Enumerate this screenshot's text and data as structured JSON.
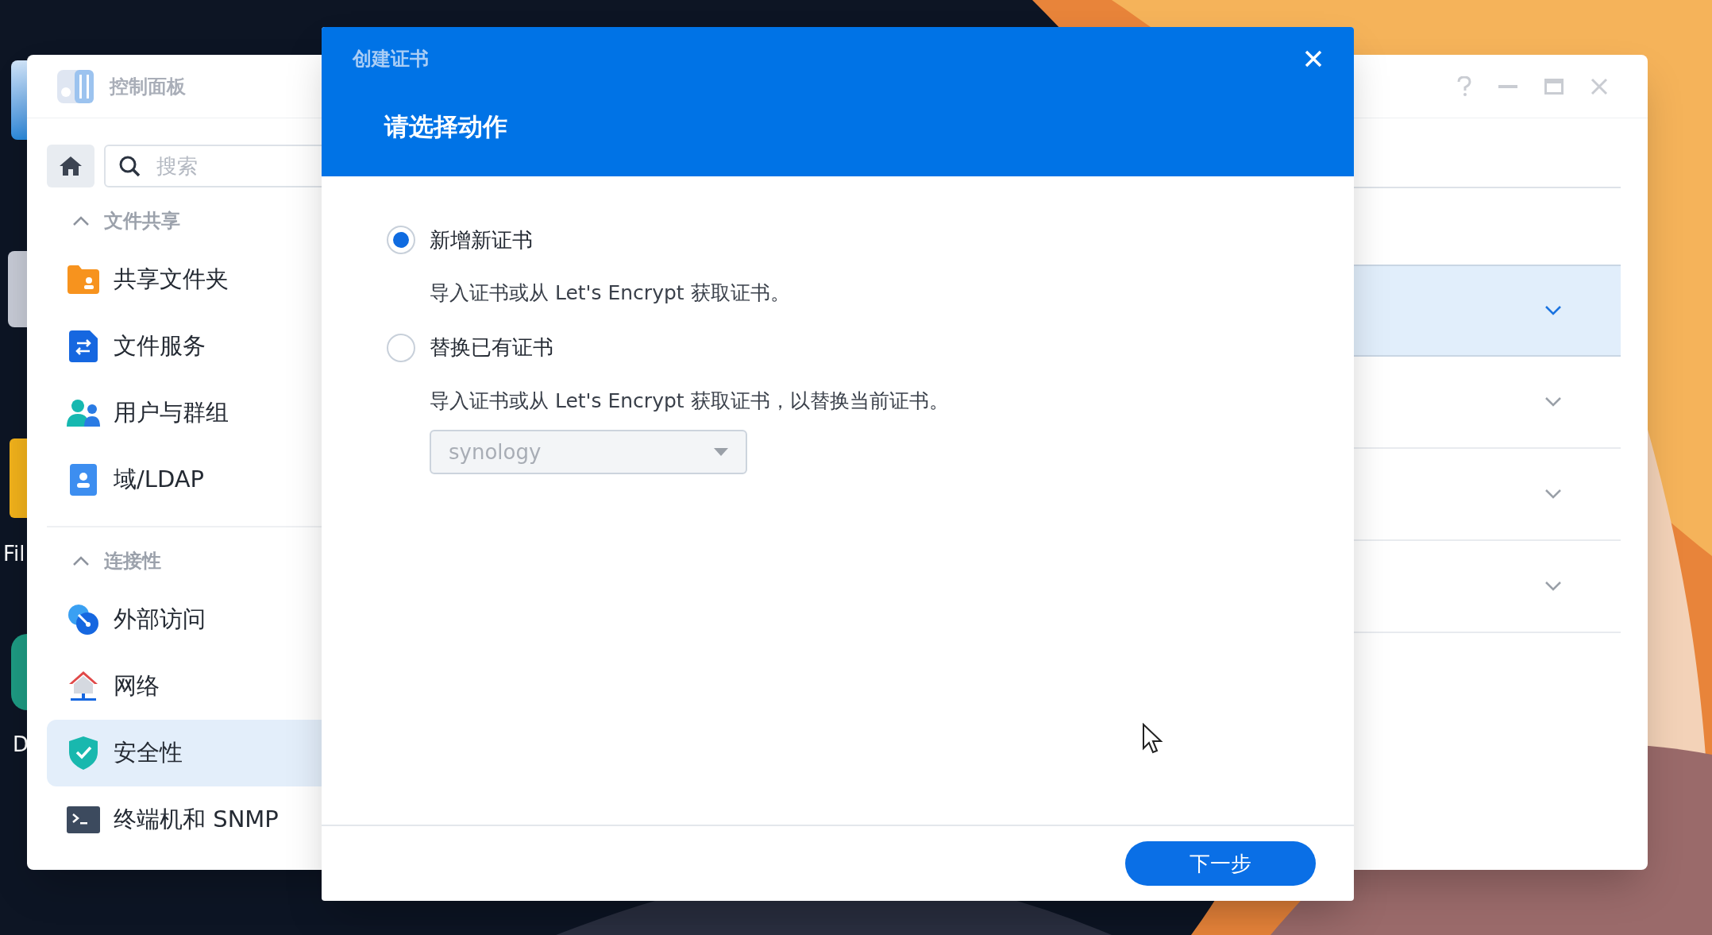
{
  "desktop": {
    "icons": [
      {
        "label": "Fil"
      },
      {
        "label": "D"
      }
    ]
  },
  "control_panel": {
    "title": "控制面板",
    "search": {
      "placeholder": "搜索"
    },
    "sections": [
      {
        "title": "文件共享",
        "expanded": true,
        "items": [
          {
            "label": "共享文件夹",
            "selected": false
          },
          {
            "label": "文件服务",
            "selected": false
          },
          {
            "label": "用户与群组",
            "selected": false
          },
          {
            "label": "域/LDAP",
            "selected": false
          }
        ]
      },
      {
        "title": "连接性",
        "expanded": true,
        "items": [
          {
            "label": "外部访问",
            "selected": false
          },
          {
            "label": "网络",
            "selected": false
          },
          {
            "label": "安全性",
            "selected": true
          },
          {
            "label": "终端机和 SNMP",
            "selected": false
          }
        ]
      }
    ],
    "rows": [
      {
        "selected": true
      },
      {
        "selected": false
      },
      {
        "selected": false
      },
      {
        "selected": false
      }
    ]
  },
  "dialog": {
    "title": "创建证书",
    "heading": "请选择动作",
    "options": [
      {
        "label": "新增新证书",
        "description": "导入证书或从 Let's Encrypt 获取证书。",
        "selected": true
      },
      {
        "label": "替换已有证书",
        "description": "导入证书或从 Let's Encrypt 获取证书，以替换当前证书。",
        "selected": false
      }
    ],
    "select": {
      "value": "synology",
      "disabled": true
    },
    "next_button": "下一步"
  }
}
